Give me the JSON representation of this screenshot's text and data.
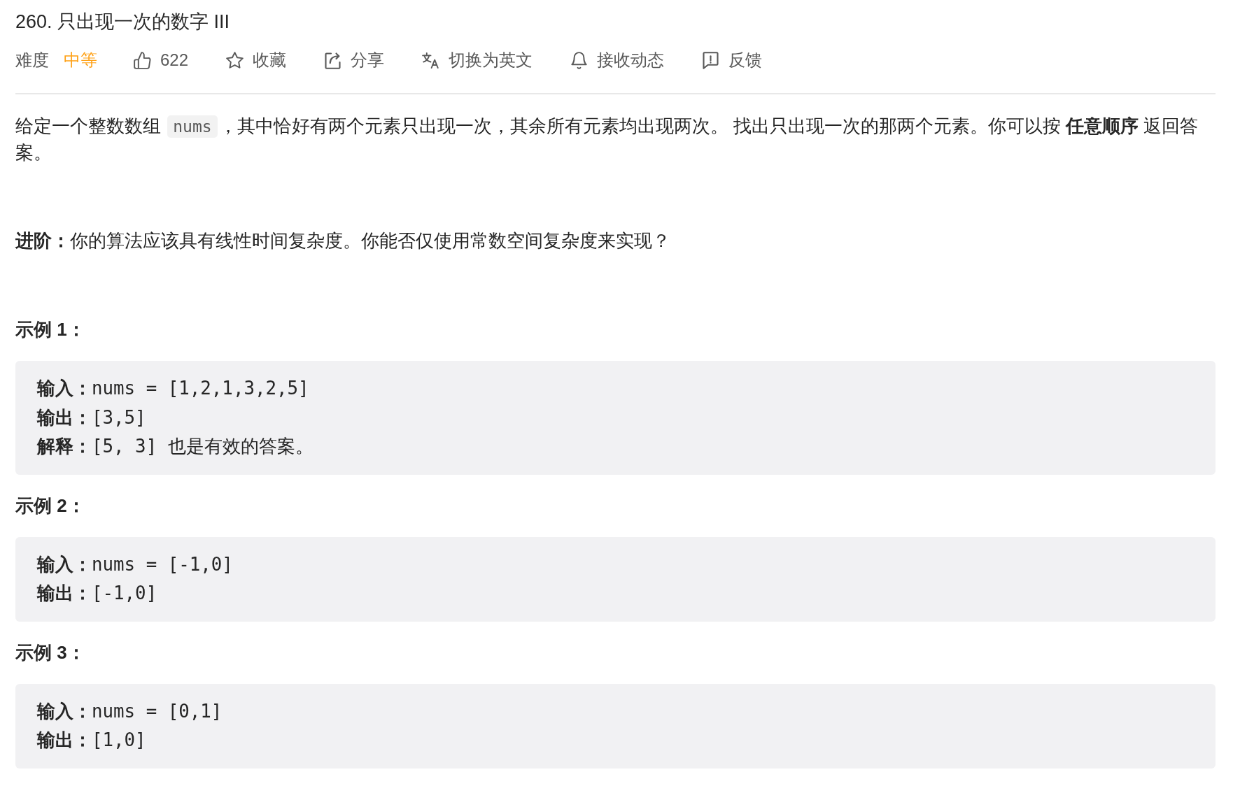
{
  "problem": {
    "title": "260. 只出现一次的数字 III",
    "difficulty_label": "难度",
    "difficulty": "中等",
    "actions": [
      {
        "label": "622"
      },
      {
        "label": "收藏"
      },
      {
        "label": "分享"
      },
      {
        "label": "切换为英文"
      },
      {
        "label": "接收动态"
      },
      {
        "label": "反馈"
      }
    ],
    "description": [
      {
        "kind": "text",
        "text": "给定一个整数数组 "
      },
      {
        "kind": "code",
        "text": "nums"
      },
      {
        "kind": "text",
        "text": "，其中恰好有两个元素只出现一次，其余所有元素均出现两次。 找出只出现一次的那两个元素。你可以按 **任意顺序** 返回答案。"
      }
    ],
    "follow_up": "**进阶：**你的算法应该具有线性时间复杂度。你能否仅使用常数空间复杂度来实现？",
    "examples": [
      {
        "heading": "示例 1：",
        "lines": [
          "**输入：**nums = [1,2,1,3,2,5]",
          "**输出：**[3,5]",
          "**解释：**[5, 3] 也是有效的答案。"
        ]
      },
      {
        "heading": "示例 2：",
        "lines": [
          "**输入：**nums = [-1,0]",
          "**输出：**[-1,0]"
        ]
      },
      {
        "heading": "示例 3：",
        "lines": [
          "**输入：**nums = [0,1]",
          "**输出：**[1,0]"
        ]
      }
    ]
  }
}
